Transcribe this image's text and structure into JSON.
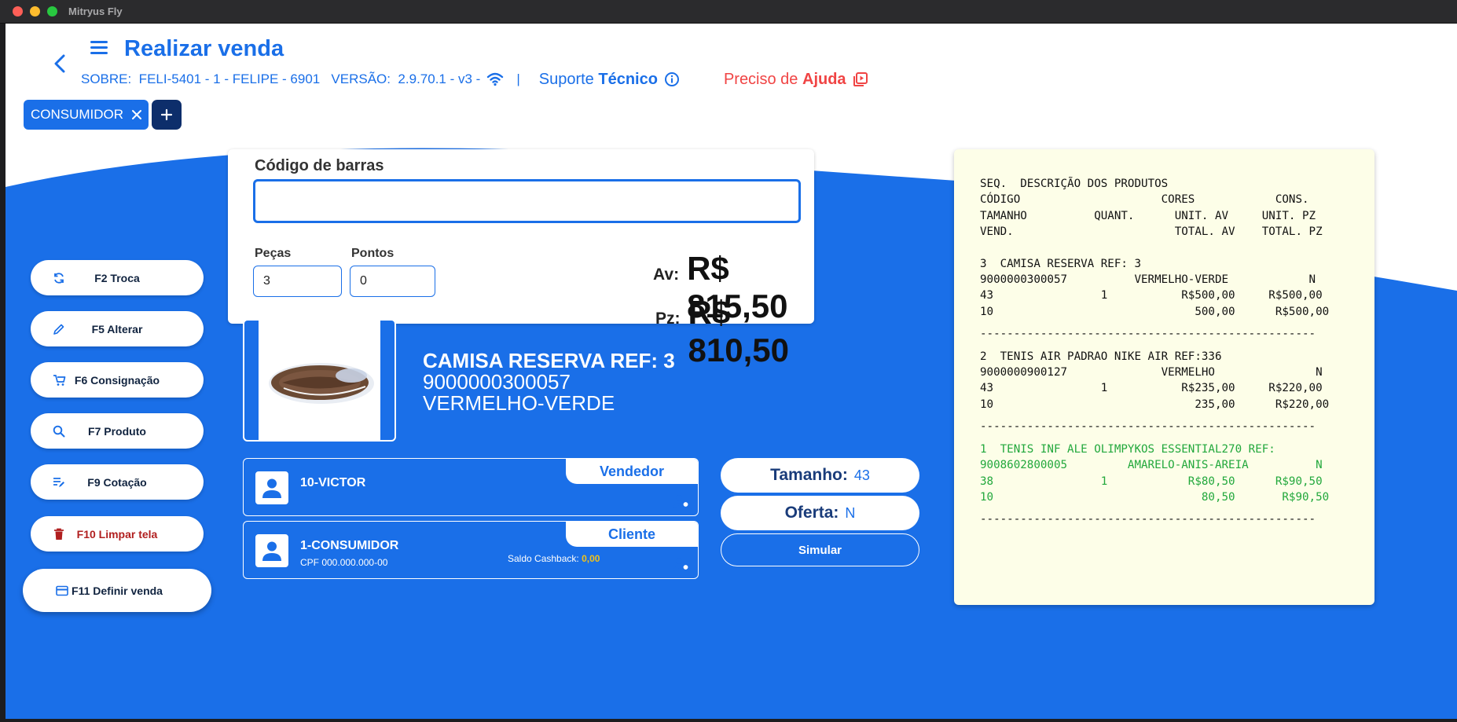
{
  "window": {
    "title": "Mitryus Fly"
  },
  "header": {
    "title": "Realizar venda",
    "info_line": "SOBRE:  FELI-5401 - 1 - FELIPE - 6901   VERSÃO:  2.9.70.1 - v3 -",
    "support_prefix": "Suporte ",
    "support_bold": "Técnico",
    "help_prefix": "Preciso de ",
    "help_bold": "Ajuda"
  },
  "customer_chip": {
    "label": "CONSUMIDOR"
  },
  "sidebar": {
    "troca": "F2 Troca",
    "alterar": "F5 Alterar",
    "consignacao": "F6 Consignação",
    "produto": "F7 Produto",
    "cotacao": "F9 Cotação",
    "limpar": "F10 Limpar tela",
    "definir": "F11 Definir venda"
  },
  "barcode": {
    "label": "Código de barras",
    "value": "",
    "pecas_label": "Peças",
    "pecas_value": "3",
    "pontos_label": "Pontos",
    "pontos_value": "0"
  },
  "totals": {
    "av_label": "Av:",
    "av_value": "R$ 815,50",
    "pz_label": "Pz:",
    "pz_value": "R$ 810,50"
  },
  "product": {
    "name": "CAMISA RESERVA REF: 3",
    "code": "9000000300057",
    "color": "VERMELHO-VERDE"
  },
  "seller": {
    "name": "10-VICTOR",
    "tag": "Vendedor"
  },
  "client": {
    "name": "1-CONSUMIDOR",
    "tag": "Cliente",
    "cpf": "CPF 000.000.000-00",
    "cashback_label": "Saldo Cashback: ",
    "cashback_value": "0,00"
  },
  "details": {
    "tamanho_label": "Tamanho:",
    "tamanho_value": "43",
    "oferta_label": "Oferta:",
    "oferta_value": "N",
    "simular": "Simular"
  },
  "receipt": {
    "header": "SEQ.  DESCRIÇÃO DOS PRODUTOS\nCÓDIGO                     CORES            CONS.\nTAMANHO          QUANT.      UNIT. AV     UNIT. PZ\nVEND.                        TOTAL. AV    TOTAL. PZ",
    "item3": "3  CAMISA RESERVA REF: 3\n9000000300057          VERMELHO-VERDE            N\n43                1           R$500,00     R$500,00\n10                              500,00      R$500,00",
    "item2": "2  TENIS AIR PADRAO NIKE AIR REF:336\n9000000900127              VERMELHO               N\n43                1           R$235,00     R$220,00\n10                              235,00      R$220,00",
    "item1": "1  TENIS INF ALE OLIMPYKOS ESSENTIAL270 REF:\n9008602800005         AMARELO-ANIS-AREIA          N\n38                1            R$80,50      R$90,50\n10                               80,50       R$90,50",
    "divider": "--------------------------------------------------"
  },
  "colors": {
    "primary": "#1a6fe8",
    "danger": "#b11f1f",
    "help": "#f04444",
    "receipt_bg": "#fdfee8",
    "highlight_item": "#22a83c"
  }
}
